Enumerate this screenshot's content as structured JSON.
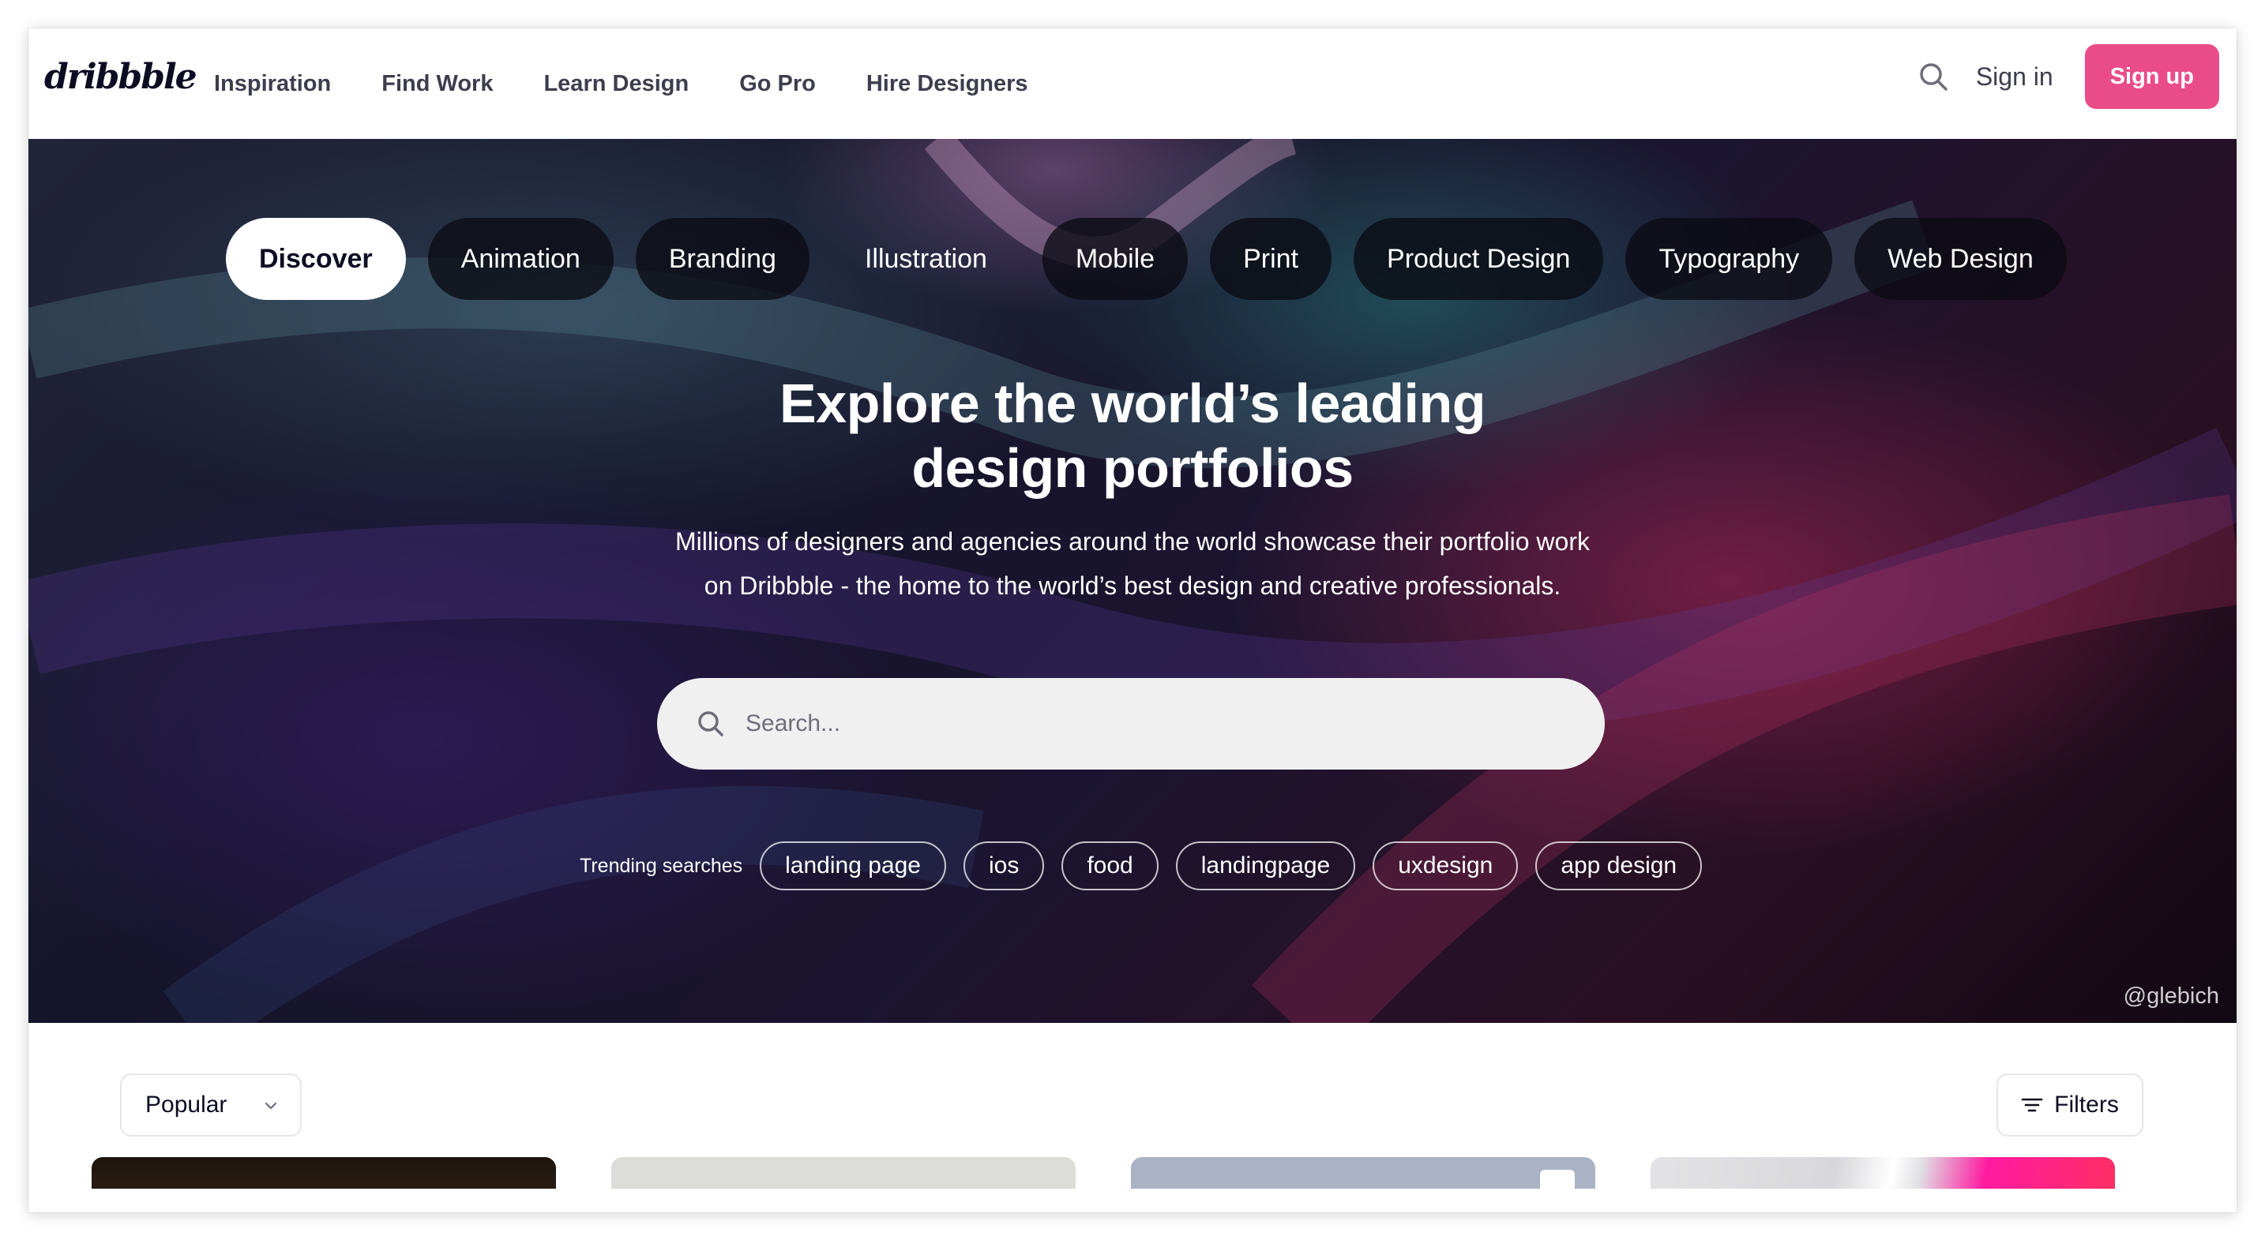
{
  "brand": {
    "logo": "dribbble",
    "accent": "#ea4c89"
  },
  "nav": {
    "items": [
      {
        "label": "Inspiration"
      },
      {
        "label": "Find Work"
      },
      {
        "label": "Learn Design"
      },
      {
        "label": "Go Pro"
      },
      {
        "label": "Hire Designers"
      }
    ],
    "search_icon": "search-icon",
    "signin_label": "Sign in",
    "signup_label": "Sign up"
  },
  "hero": {
    "categories": [
      {
        "label": "Discover",
        "active": true
      },
      {
        "label": "Animation"
      },
      {
        "label": "Branding"
      },
      {
        "label": "Illustration"
      },
      {
        "label": "Mobile"
      },
      {
        "label": "Print"
      },
      {
        "label": "Product Design"
      },
      {
        "label": "Typography"
      },
      {
        "label": "Web Design"
      }
    ],
    "title_line1": "Explore the world’s leading",
    "title_line2": "design portfolios",
    "subtitle_line1": "Millions of designers and agencies around the world showcase their portfolio work",
    "subtitle_line2": "on Dribbble - the home to the world’s best design and creative professionals.",
    "search_placeholder": "Search...",
    "trending_label": "Trending searches",
    "trending_tags": [
      "landing page",
      "ios",
      "food",
      "landingpage",
      "uxdesign",
      "app design"
    ],
    "credit": "@glebich"
  },
  "feed": {
    "sort_label": "Popular",
    "filters_label": "Filters"
  }
}
